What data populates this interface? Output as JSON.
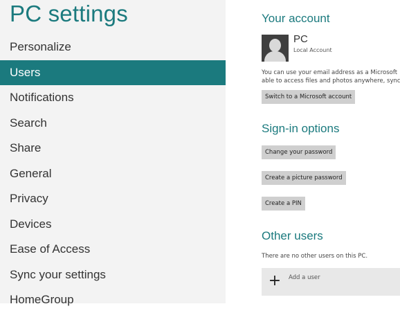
{
  "app": {
    "title": "PC settings"
  },
  "nav": {
    "items": [
      {
        "label": "Personalize"
      },
      {
        "label": "Users",
        "selected": true
      },
      {
        "label": "Notifications"
      },
      {
        "label": "Search"
      },
      {
        "label": "Share"
      },
      {
        "label": "General"
      },
      {
        "label": "Privacy"
      },
      {
        "label": "Devices"
      },
      {
        "label": "Ease of Access"
      },
      {
        "label": "Sync your settings"
      },
      {
        "label": "HomeGroup"
      }
    ]
  },
  "account": {
    "heading": "Your account",
    "name": "PC",
    "type": "Local Account",
    "info_line1": "You can use your email address as a Microsoft",
    "info_line2": "able to access files and photos anywhere, sync",
    "switch_button": "Switch to a Microsoft account"
  },
  "signin": {
    "heading": "Sign-in options",
    "change_password_button": "Change your password",
    "picture_password_button": "Create a picture password",
    "pin_button": "Create a PIN"
  },
  "other_users": {
    "heading": "Other users",
    "info": "There are no other users on this PC.",
    "add_user_label": "Add a user",
    "add_icon": "plus-icon"
  },
  "colors": {
    "accent": "#1b7a7e",
    "sidebar_bg": "#f3f3f3",
    "button_bg": "#cfcfcf"
  }
}
